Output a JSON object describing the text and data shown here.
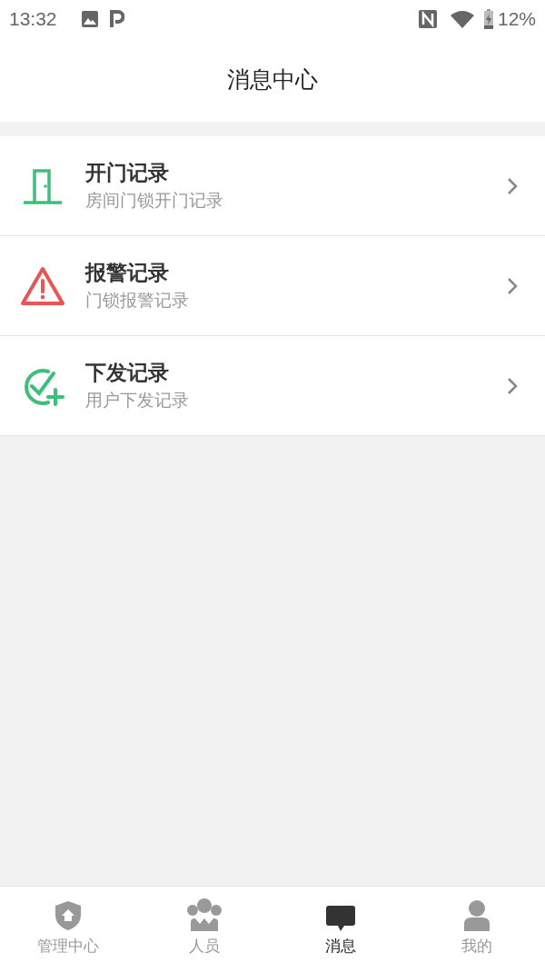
{
  "status_bar": {
    "time": "13:32",
    "battery": "12%"
  },
  "header": {
    "title": "消息中心"
  },
  "records": [
    {
      "kind": "door",
      "title": "开门记录",
      "subtitle": "房间门锁开门记录"
    },
    {
      "kind": "alarm",
      "title": "报警记录",
      "subtitle": "门锁报警记录"
    },
    {
      "kind": "issue",
      "title": "下发记录",
      "subtitle": "用户下发记录"
    }
  ],
  "tabs": [
    {
      "kind": "home",
      "label": "管理中心",
      "selected": false
    },
    {
      "kind": "people",
      "label": "人员",
      "selected": false
    },
    {
      "kind": "message",
      "label": "消息",
      "selected": true
    },
    {
      "kind": "me",
      "label": "我的",
      "selected": false
    }
  ]
}
